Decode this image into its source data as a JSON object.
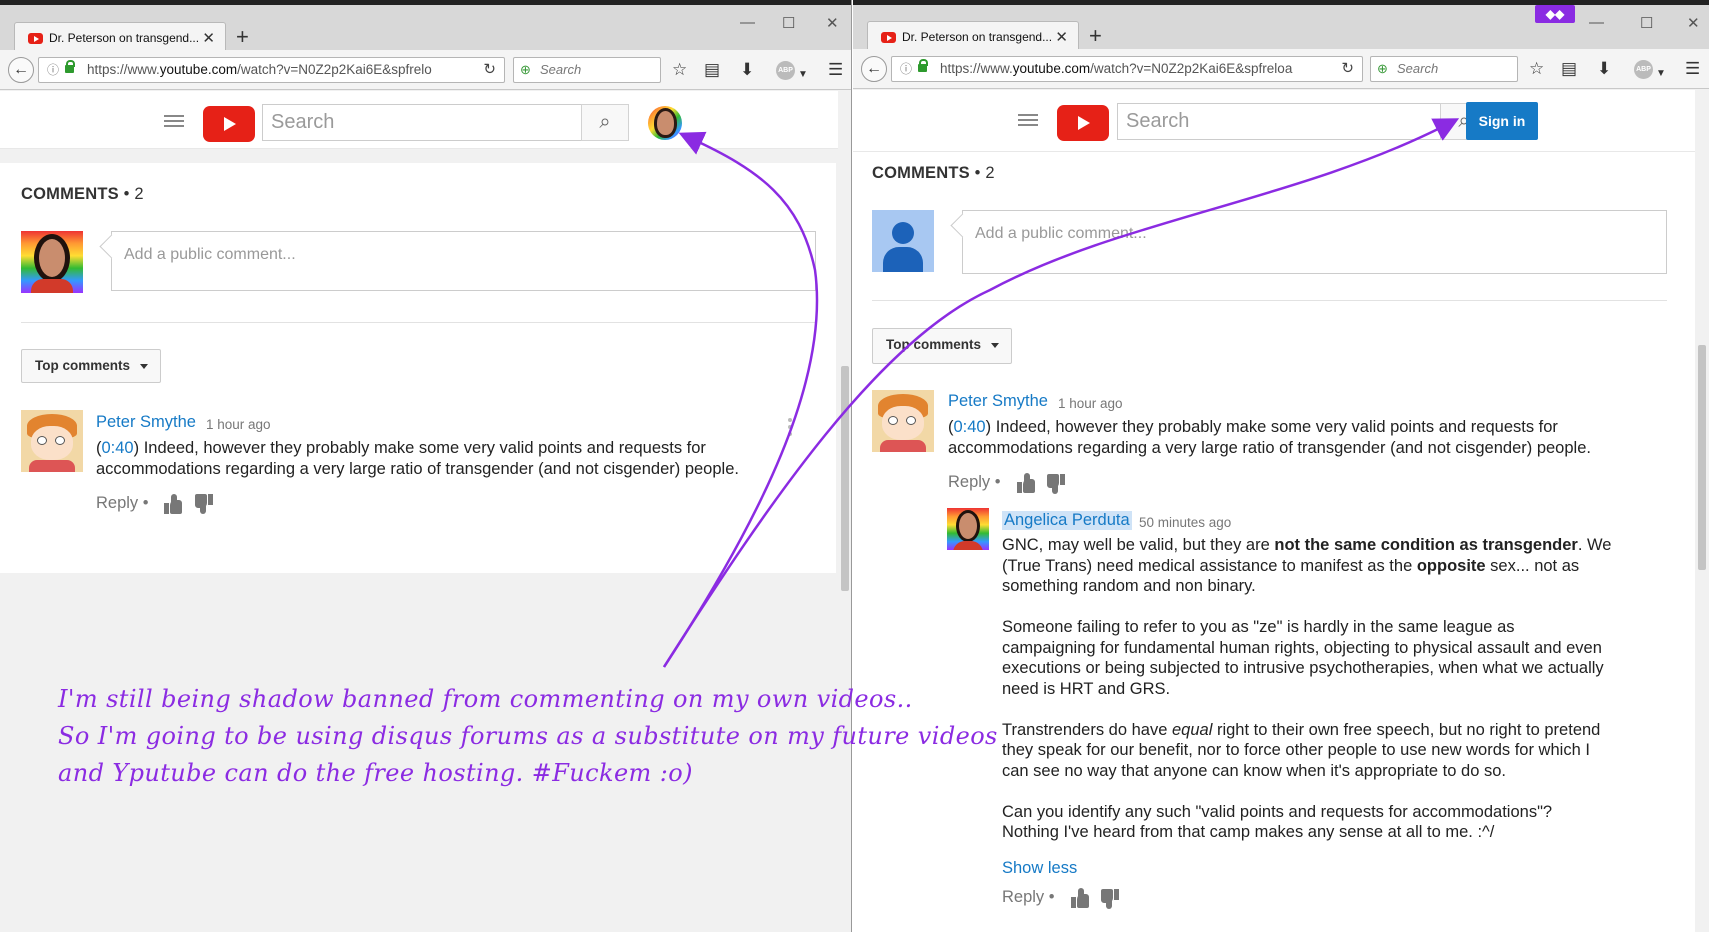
{
  "left": {
    "tab_title": "Dr. Peterson on transgend...",
    "url_prefix": "https://www.",
    "url_domain": "youtube.com",
    "url_path": "/watch?v=N0Z2p2Kai6E&spfrelo",
    "browser_search": "Search",
    "yt_search_placeholder": "Search",
    "comments_label": "COMMENTS",
    "comments_count": "• 2",
    "add_comment_placeholder": "Add a public comment...",
    "sort_label": "Top comments",
    "comment": {
      "author": "Peter Smythe",
      "time": "1 hour ago",
      "timestamp_link": "0:40",
      "text_line1_rest": ") Indeed, however they probably make some very valid points and requests for",
      "text_line2": "accommodations regarding a very large ratio of transgender (and not cisgender) people.",
      "reply": "Reply"
    }
  },
  "right": {
    "tab_title": "Dr. Peterson on transgend...",
    "url_prefix": "https://www.",
    "url_domain": "youtube.com",
    "url_path": "/watch?v=N0Z2p2Kai6E&spfreloa",
    "browser_search": "Search",
    "yt_search_placeholder": "Search",
    "sign_in": "Sign in",
    "comments_label": "COMMENTS",
    "comments_count": "• 2",
    "add_comment_placeholder": "Add a public comment...",
    "sort_label": "Top comments",
    "comment": {
      "author": "Peter Smythe",
      "time": "1 hour ago",
      "timestamp_link": "0:40",
      "text_line1_rest": ") Indeed, however they probably make some very valid points and requests for",
      "text_line2": "accommodations regarding a very large ratio of transgender (and not cisgender) people.",
      "reply": "Reply"
    },
    "reply_comment": {
      "author": "Angelica Perduta",
      "time": "50 minutes ago",
      "p1_a": "GNC, may well be valid, but they are ",
      "p1_bold": "not the same condition as transgender",
      "p1_b": ". We",
      "p1_line2_a": "(True Trans) need medical assistance to manifest as the ",
      "p1_line2_bold": "opposite",
      "p1_line2_b": " sex... not as",
      "p1_line3": "something random and non binary.",
      "p2_line1": "Someone failing to refer to you as \"ze\" is hardly in the same league as",
      "p2_line2": "campaigning for fundamental human rights, objecting to physical assault and even",
      "p2_line3": "executions or being subjected to intrusive psychotherapies, when what we actually",
      "p2_line4": "need is HRT and GRS.",
      "p3_line1_a": "Transtrenders do have ",
      "p3_line1_em": "equal",
      "p3_line1_b": " right to their own free speech, but no right to pretend",
      "p3_line2": "they speak for our benefit, nor to force other people to use new words for which I",
      "p3_line3": "can see no way that anyone can know when it's appropriate to do so.",
      "p4_line1": "Can you identify any such \"valid points and requests for accommodations\"?",
      "p4_line2": "Nothing I've heard from that camp makes any sense at all to me. :^/",
      "show_less": "Show less",
      "reply": "Reply"
    }
  },
  "annotation": {
    "line1": "I'm still being shadow banned from commenting on my own videos..",
    "line2": "So I'm going to be using disqus forums as a substitute on my future videos",
    "line3": "and Yputube can do the free hosting. #Fuckem :o)",
    "arrow_color": "#8b2be2"
  },
  "colors": {
    "youtube_red": "#e62117",
    "link_blue": "#167ac6",
    "annotation_purple": "#8b2be2"
  }
}
